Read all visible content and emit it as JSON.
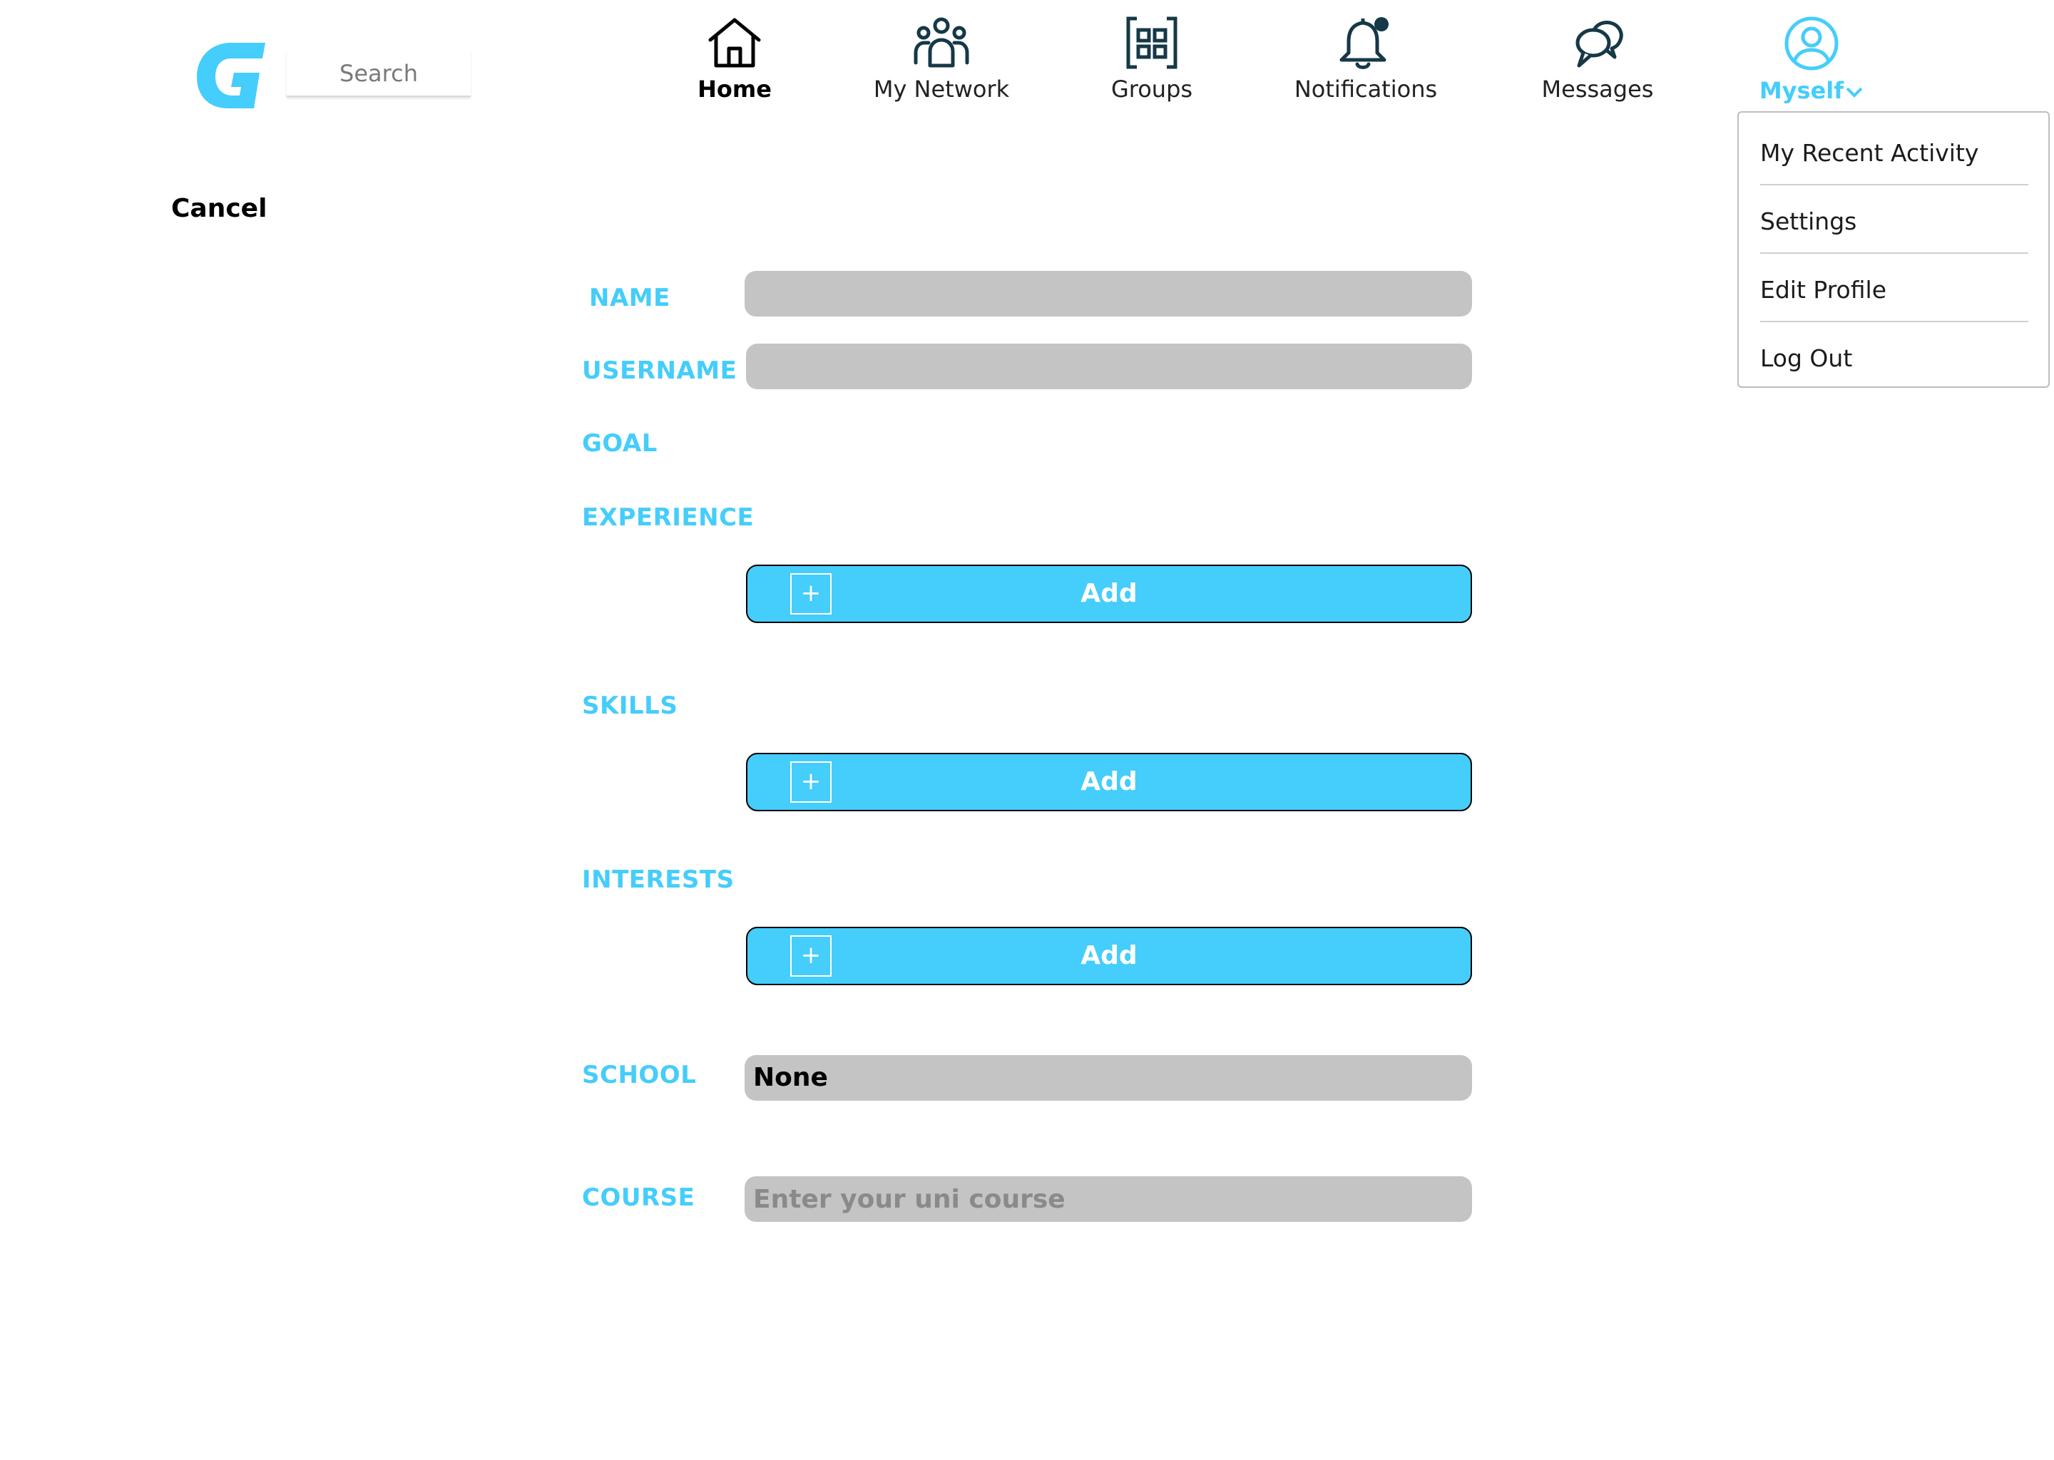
{
  "header": {
    "logo_letter": "G",
    "search_placeholder": "Search",
    "nav": [
      {
        "label": "Home",
        "icon": "home-icon"
      },
      {
        "label": "My Network",
        "icon": "network-icon"
      },
      {
        "label": "Groups",
        "icon": "groups-icon"
      },
      {
        "label": "Notifications",
        "icon": "bell-icon"
      },
      {
        "label": "Messages",
        "icon": "messages-icon"
      },
      {
        "label": "Myself",
        "icon": "user-circle-icon"
      }
    ]
  },
  "dropdown": {
    "items": [
      "My Recent Activity",
      "Settings",
      "Edit Profile",
      "Log Out"
    ]
  },
  "form": {
    "cancel_label": "Cancel",
    "name_label": "NAME",
    "username_label": "USERNAME",
    "goal_label": "GOAL",
    "experience_label": "EXPERIENCE",
    "skills_label": "SKILLS",
    "interests_label": "INTERESTS",
    "school_label": "SCHOOL",
    "course_label": "COURSE",
    "add_label": "Add",
    "add_symbol": "+",
    "school_value": "None",
    "course_placeholder": "Enter your uni course"
  },
  "colors": {
    "accent": "#45cdfb",
    "field_bg": "#c4c4c4",
    "icon_dark": "#163847"
  }
}
